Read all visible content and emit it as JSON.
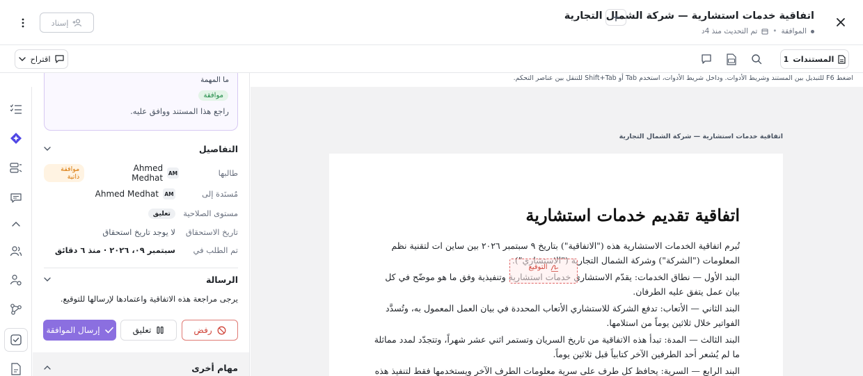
{
  "header": {
    "title": "اتفاقية خدمات استشارية — شركة الشمال التجارية",
    "status": "الموافقة",
    "updated": "تم التحديث منذ 4د",
    "assign_label": "إسناد"
  },
  "toolbar": {
    "documents_label": "المستندات",
    "documents_count": "1",
    "suggest_label": "اقتراح"
  },
  "hint": "اضغط F6 للتبديل بين المستند وشريط الأدوات. وداخل شريط الأدوات، استخدم Tab أو Shift+Tab للتنقل بين عناصر التحكم.",
  "document": {
    "caption": "اتفاقية خدمات استشارية — شركة الشمال التجارية",
    "title": "اتفاقية تقديم خدمات استشارية",
    "paragraphs": [
      "تُبرم اتفاقية الخدمات الاستشارية هذه (\"الاتفاقية\") بتاريخ ٩ سبتمبر ٢٠٢٦ بين ساين ات لتقنية نظم المعلومات (\"الشركة\") وشركة الشمال التجارية (\"الاستشاري\").",
      "البند الأول — نطاق الخدمات: يقدّم الاستشاري خدمات استشارية وتنفيذية وفق ما هو موضّح في كل بيان عمل يتفق عليه الطرفان.",
      "البند الثاني — الأتعاب: تدفع الشركة للاستشاري الأتعاب المحددة في بيان العمل المعمول به، وتُسدَّد الفواتير خلال ثلاثين يوماً من استلامها.",
      "البند الثالث — المدة: تبدأ هذه الاتفاقية من تاريخ السريان وتستمر اثني عشر شهراً، وتتجدّد لمدد مماثلة ما لم يُشعر أحد الطرفين الآخر كتابياً قبل ثلاثين يوماً.",
      "البند الرابع — السرية: يحافظ كل طرف على سرية معلومات الطرف الآخر ويستخدمها فقط لتنفيذ هذه الاتفاقية."
    ],
    "signature_label": "التوقيع"
  },
  "task": {
    "question": "ما المهمة",
    "badge": "موافقة",
    "description": "راجع هذا المستند ووافق عليه."
  },
  "details": {
    "heading": "التفاصيل",
    "requester_label": "طالبها",
    "requester_name": "Ahmed Medhat",
    "requester_initials": "AM",
    "self_approval": "موافقة ذاتية",
    "assignee_label": "مُسنَدة إلى",
    "assignee_name": "Ahmed Medhat",
    "assignee_initials": "AM",
    "permission_label": "مستوى الصلاحية",
    "permission_value": "تعليق",
    "due_label": "تاريخ الاستحقاق",
    "due_value": "لا يوجد تاريخ استحقاق",
    "requested_label": "تم الطلب في",
    "requested_value": "سبتمبر ٠٩، ٢٠٢٦ · منذ ٦ دقائق"
  },
  "message": {
    "heading": "الرسالة",
    "text": "يرجى مراجعة هذه الاتفاقية واعتمادها لإرسالها للتوقيع."
  },
  "actions": {
    "reject": "رفض",
    "suspend": "تعليق",
    "send": "إرسال الموافقة"
  },
  "other_tasks": "مهام أخرى",
  "colors": {
    "accent": "#8b6fe0",
    "reject": "#d0453a",
    "approval_green": "#1e8a45",
    "self_approval_orange": "#d97706"
  }
}
